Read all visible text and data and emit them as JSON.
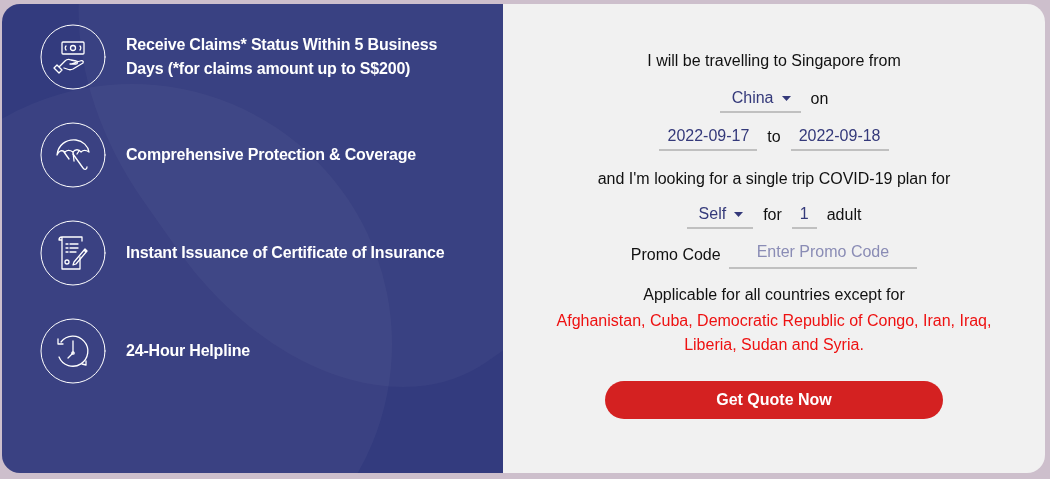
{
  "features": [
    {
      "kind": "money",
      "text": "Receive Claims* Status Within 5 Business Days (*for claims amount up to S$200)"
    },
    {
      "kind": "umbrella",
      "text": "Comprehensive Protection & Coverage"
    },
    {
      "kind": "certificate",
      "text": "Instant Issuance of Certificate of Insurance"
    },
    {
      "kind": "clock",
      "text": "24-Hour Helpline"
    }
  ],
  "form": {
    "intro": "I will be travelling to Singapore from",
    "origin": "China",
    "on_label": "on",
    "date_from": "2022-09-17",
    "to_label": "to",
    "date_to": "2022-09-18",
    "plan_text": "and I'm looking for a single trip COVID-19 plan for",
    "traveller": "Self",
    "for_label": "for",
    "count": "1",
    "adult_label": "adult",
    "promo_label": "Promo Code",
    "promo_placeholder": "Enter Promo Code",
    "applicable_text": "Applicable for all countries except for",
    "excluded_countries": "Afghanistan, Cuba, Democratic Republic of Congo, Iran, Iraq, Liberia, Sudan and Syria.",
    "button": "Get Quote Now"
  }
}
